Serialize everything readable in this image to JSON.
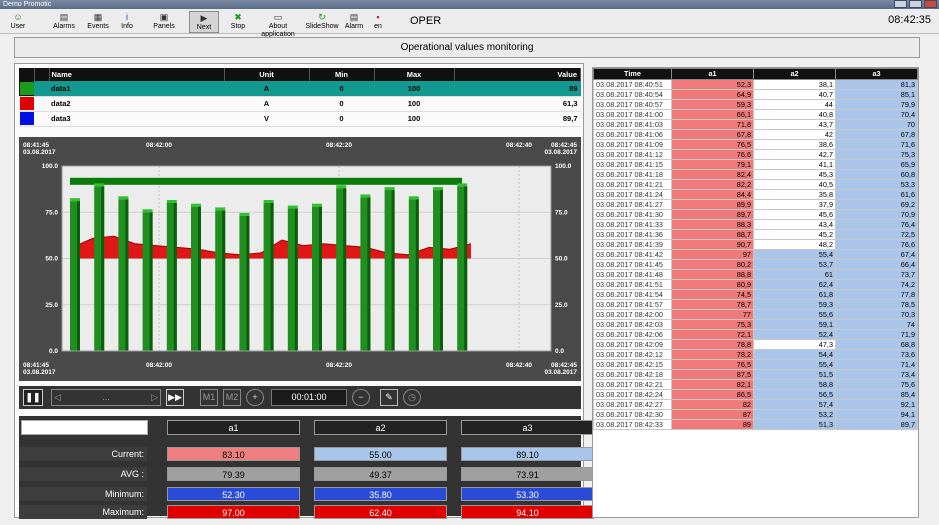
{
  "window": {
    "title": "Demo Promotic"
  },
  "toolbar": {
    "items": [
      {
        "label": "User",
        "icon": "user-icon"
      },
      {
        "label": "Alarms",
        "icon": "alarms-icon"
      },
      {
        "label": "Events",
        "icon": "events-icon"
      },
      {
        "label": "Info",
        "icon": "info-icon"
      },
      {
        "label": "Panels",
        "icon": "panels-icon"
      },
      {
        "label": "Next",
        "icon": "next-icon"
      },
      {
        "label": "Stop",
        "icon": "stop-icon"
      },
      {
        "label": "About application",
        "icon": "about-icon"
      },
      {
        "label": "SlideShow",
        "icon": "slideshow-icon"
      },
      {
        "label": "Alarm",
        "icon": "alarm-icon"
      },
      {
        "label": "en",
        "icon": "flag-icon"
      }
    ],
    "mode": "OPER",
    "clock": "08:42:35"
  },
  "page_title": "Operational values monitoring",
  "legend": {
    "headers": [
      "Name",
      "Unit",
      "Min",
      "Max",
      "Value"
    ],
    "rows": [
      {
        "name": "data1",
        "unit": "A",
        "min": "0",
        "max": "100",
        "value": "89",
        "color": "#1a9b1a"
      },
      {
        "name": "data2",
        "unit": "A",
        "min": "0",
        "max": "100",
        "value": "61,3",
        "color": "#e00000"
      },
      {
        "name": "data3",
        "unit": "V",
        "min": "0",
        "max": "100",
        "value": "89,7",
        "color": "#0010e0"
      }
    ]
  },
  "chart_data": {
    "type": "bar",
    "title": "",
    "x_ticks_top": [
      {
        "time": "08:41:45",
        "date": "03.08.2017"
      },
      {
        "time": "08:42:00",
        "date": ""
      },
      {
        "time": "08:42:20",
        "date": ""
      },
      {
        "time": "08:42:40",
        "date": ""
      },
      {
        "time": "08:42:45",
        "date": "03.08.2017"
      }
    ],
    "x_ticks_bottom": [
      {
        "time": "08:41:45",
        "date": "03.08.2017"
      },
      {
        "time": "08:42:00",
        "date": ""
      },
      {
        "time": "08:42:20",
        "date": ""
      },
      {
        "time": "08:42:40",
        "date": ""
      },
      {
        "time": "08:42:45",
        "date": "03.08.2017"
      }
    ],
    "y_ticks": [
      "100.0",
      "75.0",
      "50.0",
      "25.0",
      "0.0"
    ],
    "ylim": [
      0,
      100
    ],
    "series": [
      {
        "name": "data1",
        "color": "#1a8a1a",
        "kind": "bar",
        "values": [
          81,
          89,
          82,
          75,
          80,
          78,
          76,
          73,
          80,
          77,
          78,
          88,
          83,
          87,
          82,
          87,
          89
        ]
      },
      {
        "name": "data2",
        "color": "#e00000",
        "kind": "line",
        "values": [
          56,
          61,
          62,
          58,
          57,
          56,
          55,
          53,
          52,
          53,
          60,
          57,
          58,
          57,
          56,
          53,
          52,
          56,
          55,
          58
        ]
      },
      {
        "name": "data3",
        "color": "#0a7a0a",
        "kind": "level",
        "values": [
          92
        ]
      }
    ]
  },
  "controls": {
    "time_window": "00:01:00",
    "mark1": "M1",
    "mark2": "M2",
    "dots": "..."
  },
  "stats": {
    "columns": [
      "a1",
      "a2",
      "a3"
    ],
    "rows": [
      {
        "label": "Current:",
        "values": [
          "83.10",
          "55.00",
          "89.10"
        ]
      },
      {
        "label": "AVG :",
        "values": [
          "79.39",
          "49.37",
          "73.91"
        ]
      },
      {
        "label": "Minimum:",
        "values": [
          "52.30",
          "35.80",
          "53.30"
        ]
      },
      {
        "label": "Maximum:",
        "values": [
          "97.00",
          "62.40",
          "94.10"
        ]
      }
    ],
    "colors": {
      "current": [
        "#f08080",
        "#a9c6ea",
        "#a9c6ea"
      ],
      "avg": [
        "#a0a0a0",
        "#a0a0a0",
        "#a0a0a0"
      ],
      "minimum": [
        "#2a4bd8",
        "#2a4bd8",
        "#2a4bd8"
      ],
      "maximum": [
        "#e00000",
        "#e00000",
        "#e00000"
      ]
    }
  },
  "history": {
    "headers": [
      "Time",
      "a1",
      "a2",
      "a3"
    ],
    "rows": [
      [
        "03.08.2017 08:40:51",
        "52,3",
        "38,1",
        "81,3"
      ],
      [
        "03.08.2017 08:40:54",
        "64,9",
        "40,7",
        "85,1"
      ],
      [
        "03.08.2017 08:40:57",
        "59,3",
        "44",
        "79,9"
      ],
      [
        "03.08.2017 08:41:00",
        "66,1",
        "40,8",
        "70,4"
      ],
      [
        "03.08.2017 08:41:03",
        "71,8",
        "43,7",
        "70"
      ],
      [
        "03.08.2017 08:41:06",
        "67,8",
        "42",
        "67,8"
      ],
      [
        "03.08.2017 08:41:09",
        "76,5",
        "38,6",
        "71,6"
      ],
      [
        "03.08.2017 08:41:12",
        "76,6",
        "42,7",
        "75,3"
      ],
      [
        "03.08.2017 08:41:15",
        "79,1",
        "41,1",
        "65,9"
      ],
      [
        "03.08.2017 08:41:18",
        "82,4",
        "45,3",
        "60,8"
      ],
      [
        "03.08.2017 08:41:21",
        "82,2",
        "40,5",
        "53,3"
      ],
      [
        "03.08.2017 08:41:24",
        "84,4",
        "35,8",
        "61,6"
      ],
      [
        "03.08.2017 08:41:27",
        "89,9",
        "37,9",
        "69,2"
      ],
      [
        "03.08.2017 08:41:30",
        "89,7",
        "45,6",
        "70,9"
      ],
      [
        "03.08.2017 08:41:33",
        "88,3",
        "43,4",
        "76,4"
      ],
      [
        "03.08.2017 08:41:36",
        "88,7",
        "45,2",
        "72,5"
      ],
      [
        "03.08.2017 08:41:39",
        "90,7",
        "48,2",
        "76,6"
      ],
      [
        "03.08.2017 08:41:42",
        "97",
        "55,4",
        "67,4"
      ],
      [
        "03.08.2017 08:41:45",
        "80,2",
        "53,7",
        "66,4"
      ],
      [
        "03.08.2017 08:41:48",
        "88,8",
        "61",
        "73,7"
      ],
      [
        "03.08.2017 08:41:51",
        "80,9",
        "62,4",
        "74,2"
      ],
      [
        "03.08.2017 08:41:54",
        "74,5",
        "61,8",
        "77,8"
      ],
      [
        "03.08.2017 08:41:57",
        "78,7",
        "59,3",
        "78,5"
      ],
      [
        "03.08.2017 08:42:00",
        "77",
        "55,6",
        "70,3"
      ],
      [
        "03.08.2017 08:42:03",
        "75,3",
        "59,1",
        "74"
      ],
      [
        "03.08.2017 08:42:06",
        "72,1",
        "52,4",
        "71,9"
      ],
      [
        "03.08.2017 08:42:09",
        "78,8",
        "47,3",
        "68,8"
      ],
      [
        "03.08.2017 08:42:12",
        "78,2",
        "54,4",
        "73,6"
      ],
      [
        "03.08.2017 08:42:15",
        "76,5",
        "55,4",
        "71,4"
      ],
      [
        "03.08.2017 08:42:18",
        "87,5",
        "51,5",
        "73,4"
      ],
      [
        "03.08.2017 08:42:21",
        "82,1",
        "58,8",
        "75,6"
      ],
      [
        "03.08.2017 08:42:24",
        "86,5",
        "56,5",
        "85,4"
      ],
      [
        "03.08.2017 08:42:27",
        "82",
        "57,4",
        "92,1"
      ],
      [
        "03.08.2017 08:42:30",
        "87",
        "53,2",
        "94,1"
      ],
      [
        "03.08.2017 08:42:33",
        "89",
        "51,3",
        "89,7"
      ]
    ],
    "cell_colors": {
      "a1": "#f07a7a",
      "a2_low": "#ffffff",
      "a2_high": "#a9c6ea",
      "a3": "#a9c6ea"
    }
  }
}
